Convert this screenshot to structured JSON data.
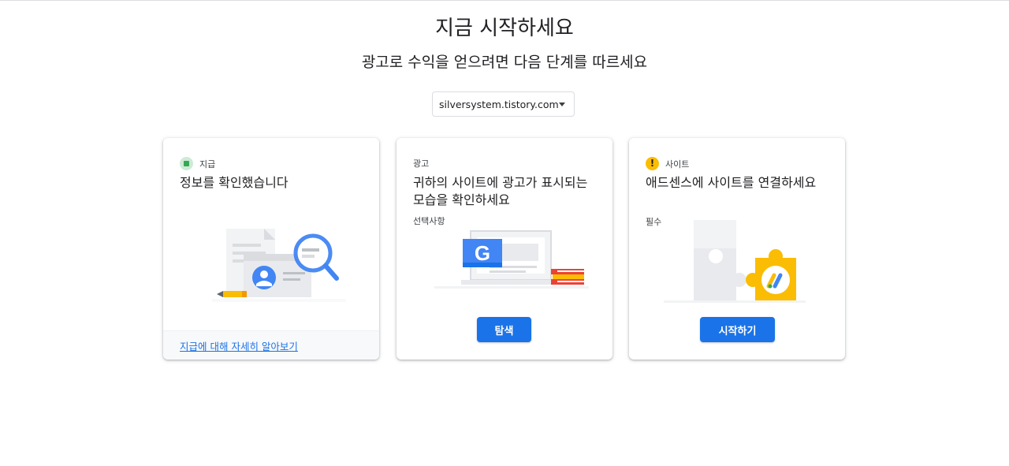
{
  "header": {
    "title": "지금 시작하세요",
    "subtitle": "광고로 수익을 얻으려면 다음 단계를 따르세요"
  },
  "site_selector": {
    "value": "silversystem.tistory.com"
  },
  "cards": [
    {
      "status_label": "지급",
      "title": "정보를 확인했습니다",
      "footer_link": "지급에 대해 자세히 알아보기",
      "status_color": "#34a853"
    },
    {
      "category_label": "광고",
      "title": "귀하의 사이트에 광고가 표시되는 모습을 확인하세요",
      "sub_label": "선택사항",
      "button_label": "탐색",
      "logo_letter": "G"
    },
    {
      "status_label": "사이트",
      "status_icon_text": "!",
      "title": "애드센스에 사이트를 연결하세요",
      "sub_label": "필수",
      "button_label": "시작하기",
      "status_color": "#fbbc04"
    }
  ],
  "colors": {
    "accent": "#1a73e8",
    "success": "#34a853",
    "warning": "#fbbc04"
  }
}
